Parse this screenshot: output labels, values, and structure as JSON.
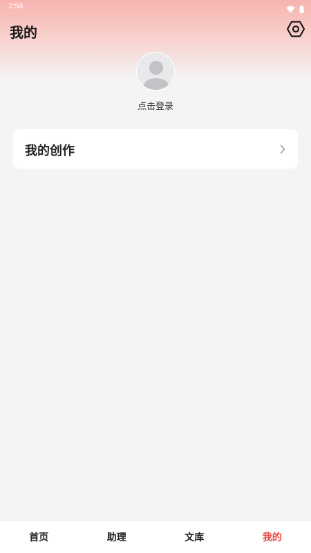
{
  "status_bar": {
    "time": "2:58",
    "icons": [
      "wifi-icon",
      "battery-icon"
    ]
  },
  "header": {
    "title": "我的",
    "settings_icon": "settings-icon"
  },
  "profile": {
    "avatar_icon": "default-avatar-icon",
    "login_text": "点击登录"
  },
  "menu": {
    "items": [
      {
        "label": "我的创作",
        "icon": "chevron-right-icon"
      }
    ]
  },
  "bottom_nav": {
    "items": [
      {
        "label": "首页",
        "active": false
      },
      {
        "label": "助理",
        "active": false
      },
      {
        "label": "文库",
        "active": false
      },
      {
        "label": "我的",
        "active": true
      }
    ]
  },
  "colors": {
    "accent": "#e8473e",
    "header_gradient_top": "#f7b4b0",
    "background": "#f4f4f4"
  }
}
